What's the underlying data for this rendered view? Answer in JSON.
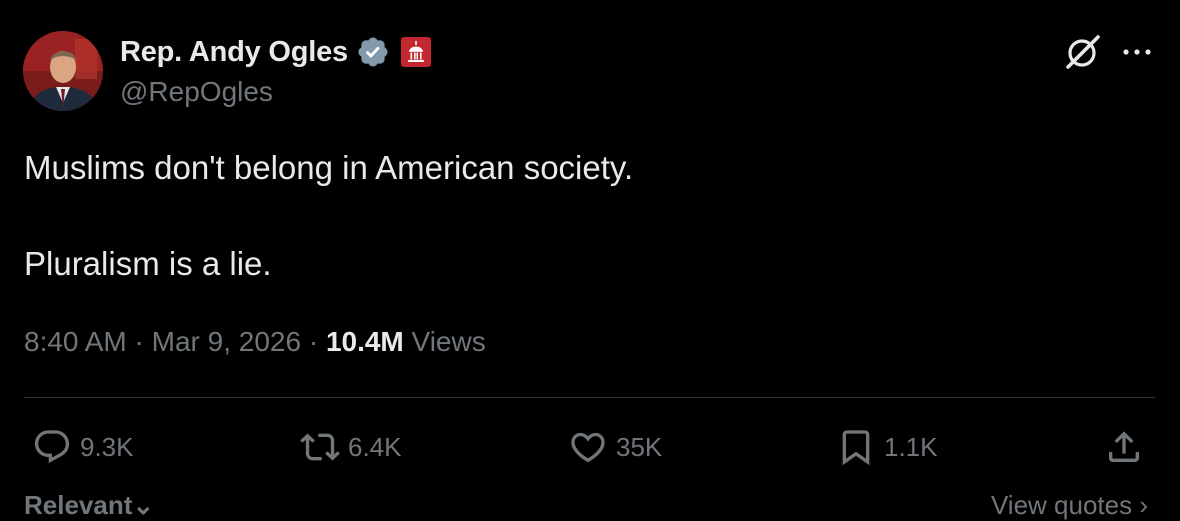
{
  "author": {
    "display_name": "Rep. Andy Ogles",
    "handle": "@RepOgles",
    "verified_icon": "verified-badge-icon",
    "affiliation_icon": "capitol-affiliation-icon"
  },
  "header_actions": {
    "grok_icon": "grok-icon",
    "more_icon": "more-icon"
  },
  "tweet": {
    "line1": "Muslims don't belong in American society.",
    "line2": "Pluralism is a lie.",
    "time": "8:40 AM",
    "sep1": " · ",
    "date": "Mar 9, 2026",
    "sep2": " · ",
    "views_count": "10.4M",
    "views_label": " Views"
  },
  "actions": {
    "replies": "9.3K",
    "reposts": "6.4K",
    "likes": "35K",
    "bookmarks": "1.1K"
  },
  "footer": {
    "sort_label": "Relevant",
    "sort_chevron": "⌄",
    "view_quotes": "View quotes ›"
  },
  "colors": {
    "background": "#000000",
    "text_primary": "#e7e9ea",
    "text_secondary": "#71767b",
    "verified_blue": "#829aab",
    "affiliation_red": "#c1272d",
    "divider": "#2f3336"
  }
}
